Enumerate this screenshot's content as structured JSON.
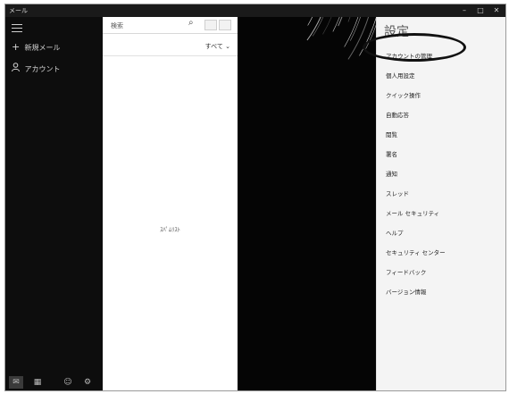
{
  "window": {
    "title": "メール",
    "controls": {
      "minimize": "–",
      "maximize": "□",
      "close": "✕"
    }
  },
  "nav": {
    "new_mail": {
      "icon": "+",
      "label": "新規メール"
    },
    "account": {
      "icon": "person-icon",
      "label": "アカウント"
    },
    "bottom": [
      {
        "icon": "mail-icon",
        "glyph": "✉",
        "selected": true
      },
      {
        "icon": "calendar-icon",
        "glyph": "▦",
        "selected": false
      },
      {
        "icon": "people-icon",
        "glyph": "☺",
        "selected": false
      },
      {
        "icon": "settings-icon",
        "glyph": "⚙",
        "selected": false
      }
    ]
  },
  "list": {
    "search_placeholder": "検索",
    "filter": "すべて ⌄",
    "empty_message": "ｽﾊﾟﾑﾘｽﾄ"
  },
  "settings": {
    "heading": "設定",
    "items": [
      "アカウントの管理",
      "個人用設定",
      "クイック操作",
      "自動応答",
      "閲覧",
      "署名",
      "通知",
      "スレッド",
      "メール セキュリティ",
      "ヘルプ",
      "セキュリティ センター",
      "フィードバック",
      "バージョン情報"
    ],
    "highlighted_item": "アカウントの管理"
  }
}
